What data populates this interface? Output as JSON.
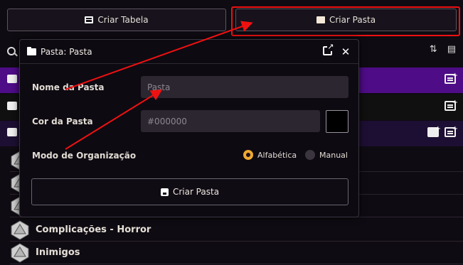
{
  "top_buttons": {
    "create_table": "Criar Tabela",
    "create_folder": "Criar Pasta"
  },
  "dialog": {
    "title": "Pasta: Pasta",
    "name_label": "Nome da Pasta",
    "name_placeholder": "Pasta",
    "color_label": "Cor da Pasta",
    "color_value": "#000000",
    "org_label": "Modo de Organização",
    "org_options": [
      "Alfabética",
      "Manual"
    ],
    "org_selected": "Alfabética",
    "submit_label": "Criar Pasta"
  },
  "list": {
    "items": [
      "Complicações - Horror",
      "Inimigos"
    ]
  },
  "colors": {
    "accent": "#f0a830",
    "folder_purple": "#4e0c87",
    "highlight_red": "#ee1111"
  }
}
